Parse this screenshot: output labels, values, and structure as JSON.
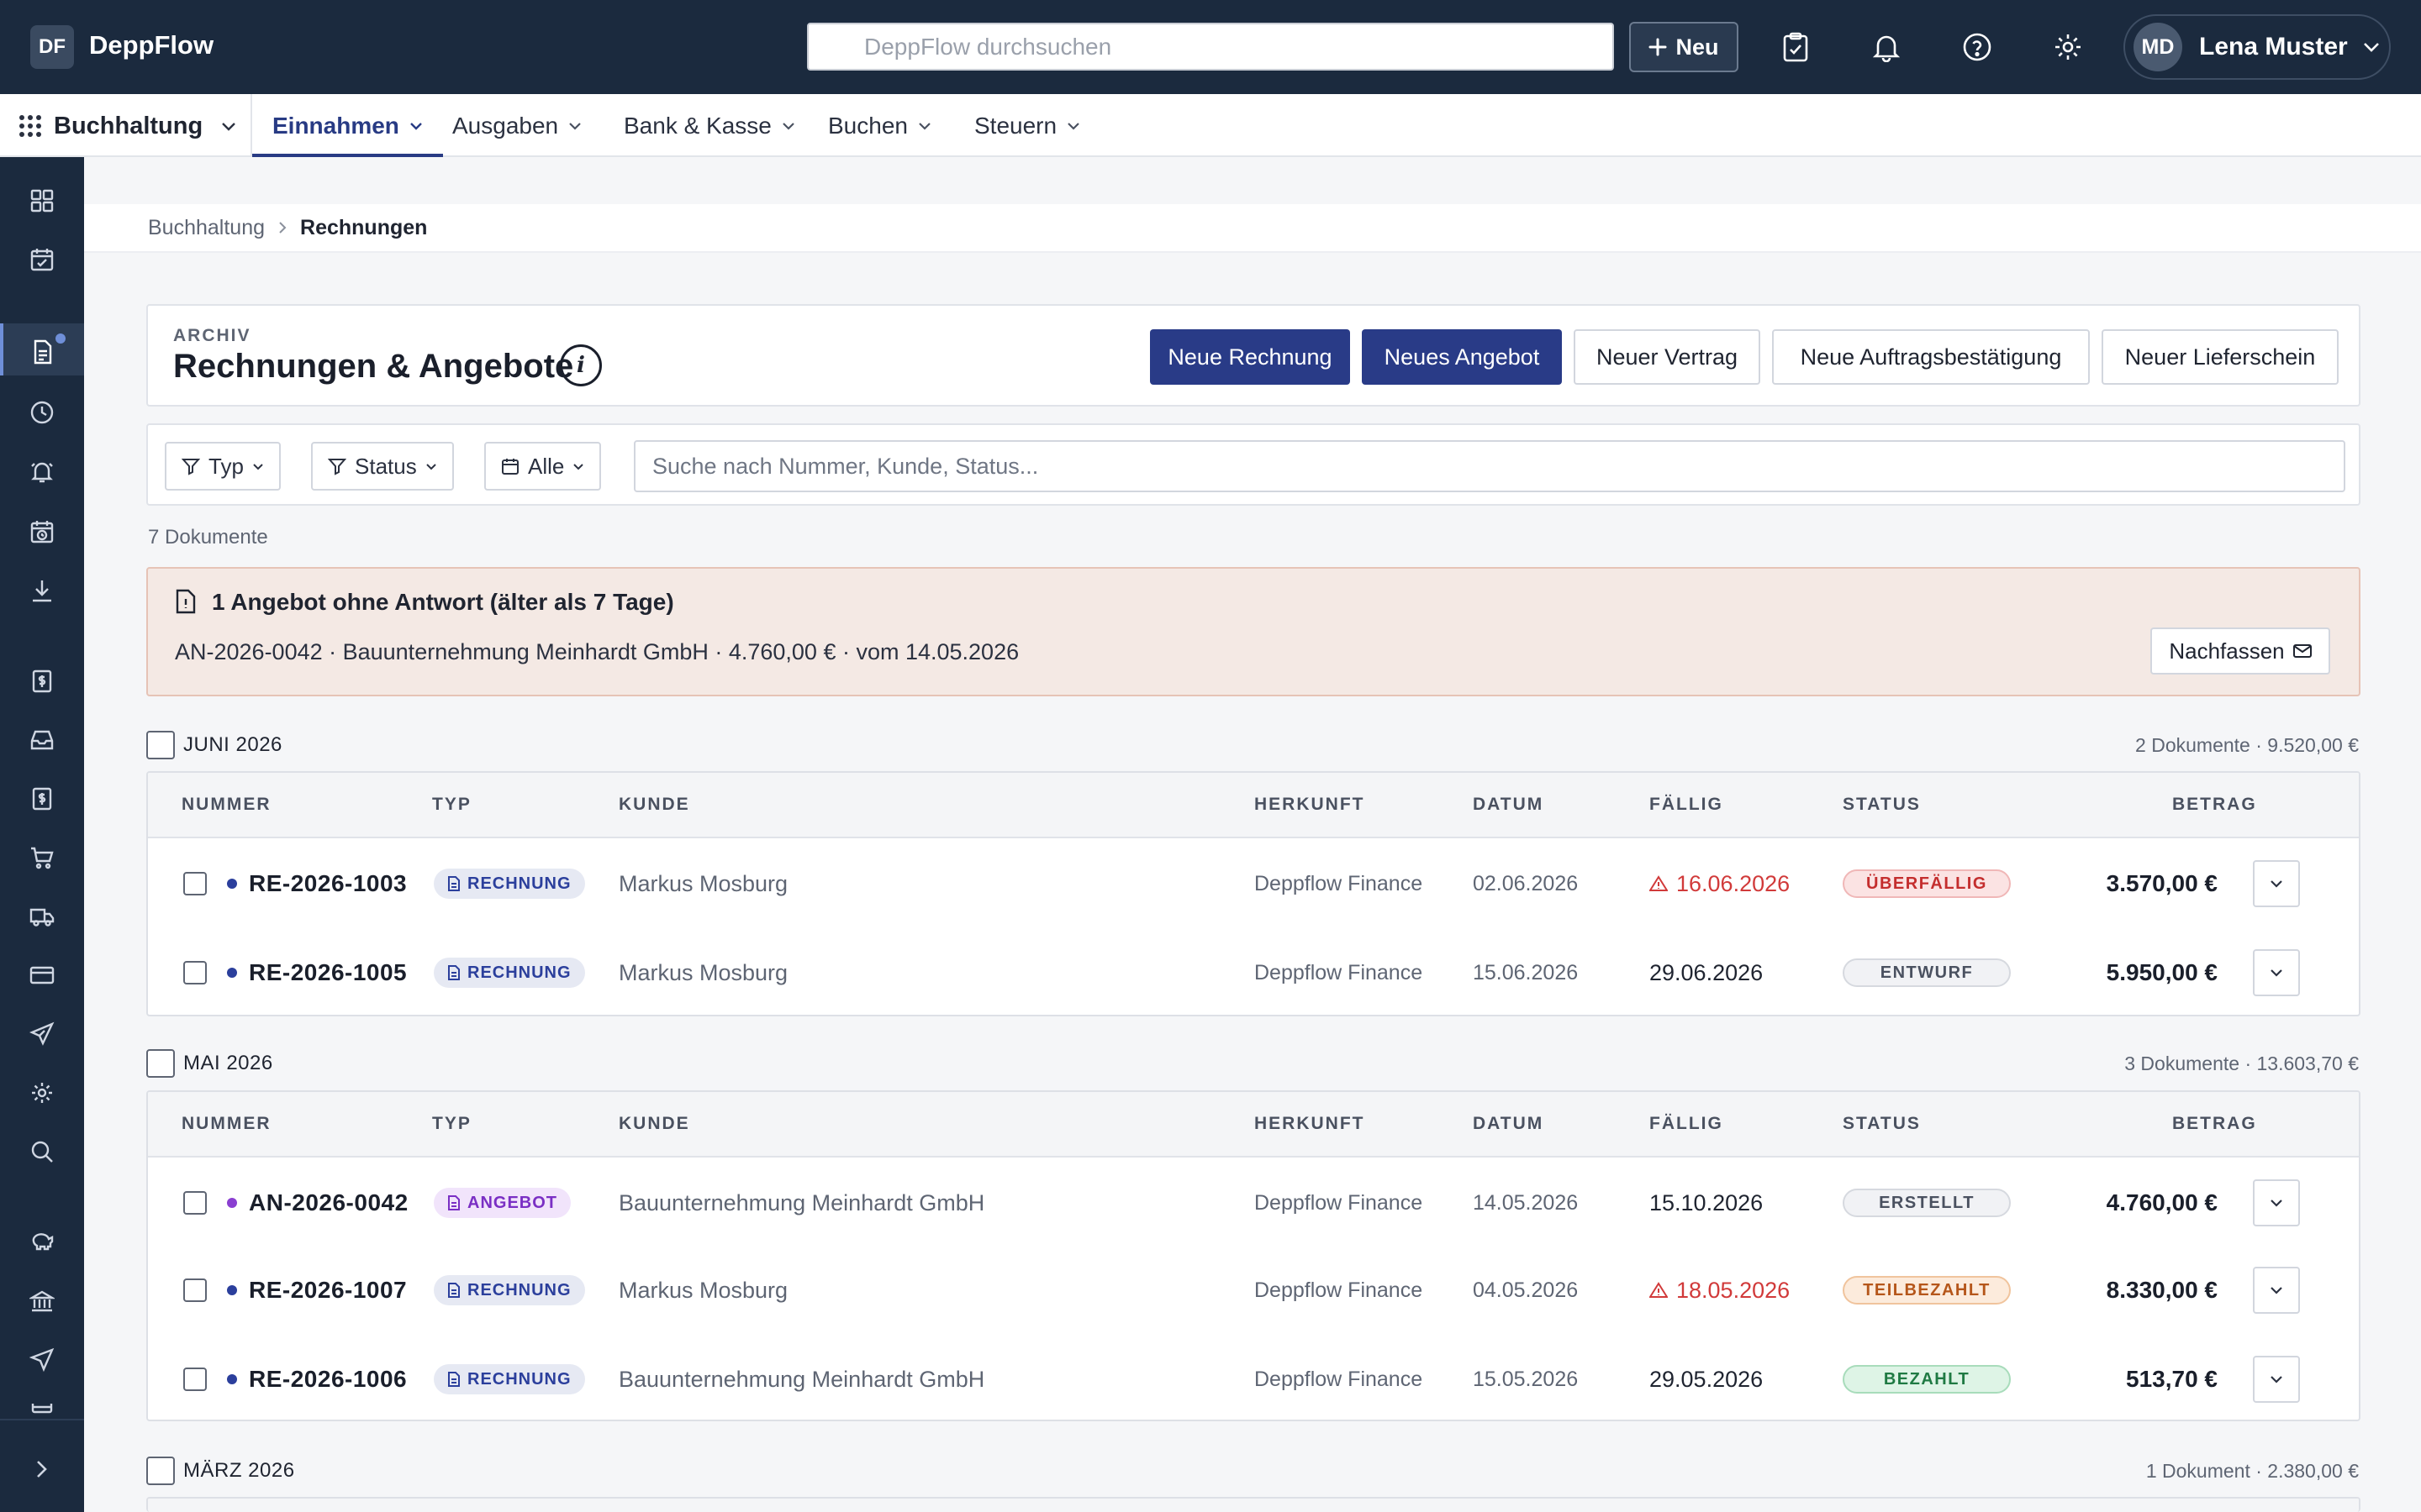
{
  "app": {
    "logo": "DF",
    "name": "DeppFlow"
  },
  "search": {
    "placeholder": "DeppFlow durchsuchen"
  },
  "top": {
    "new_label": "Neu"
  },
  "user": {
    "initials": "MD",
    "name": "Lena Muster"
  },
  "module": {
    "name": "Buchhaltung"
  },
  "nav": [
    {
      "label": "Einnahmen",
      "active": true
    },
    {
      "label": "Ausgaben"
    },
    {
      "label": "Bank & Kasse"
    },
    {
      "label": "Buchen"
    },
    {
      "label": "Steuern"
    }
  ],
  "sidebar_icons": [
    "dashboard-icon",
    "calendar-check-icon",
    "document-icon",
    "clock-icon",
    "bell-icon",
    "calendar-clock-icon",
    "download-icon",
    "invoice-icon",
    "inbox-icon",
    "receipt-icon",
    "cart-icon",
    "truck-icon",
    "card-icon",
    "plane-icon",
    "gear-icon",
    "search-icon",
    "piggy-bank-icon",
    "bank-icon",
    "send-icon",
    "printer-icon",
    "chevron-right-icon"
  ],
  "breadcrumb": {
    "parent": "Buchhaltung",
    "current": "Rechnungen"
  },
  "header": {
    "eyebrow": "ARCHIV",
    "title": "Rechnungen & Angebote",
    "buttons": [
      "Neue Rechnung",
      "Neues Angebot",
      "Neuer Vertrag",
      "Neue Auftragsbestätigung",
      "Neuer Lieferschein"
    ]
  },
  "filters": {
    "type": "Typ",
    "status": "Status",
    "period": "Alle",
    "search_placeholder": "Suche nach Nummer, Kunde, Status..."
  },
  "doc_count": "7 Dokumente",
  "alert": {
    "title": "1 Angebot ohne Antwort (älter als 7 Tage)",
    "text": "AN-2026-0042 · Bauunternehmung Meinhardt GmbH · 4.760,00 € · vom 14.05.2026",
    "button": "Nachfassen"
  },
  "columns": [
    "NUMMER",
    "TYP",
    "KUNDE",
    "HERKUNFT",
    "DATUM",
    "FÄLLIG",
    "STATUS",
    "BETRAG"
  ],
  "groups": [
    {
      "title": "JUNI 2026",
      "summary": "2 Dokumente · 9.520,00 €",
      "rows": [
        {
          "number": "RE-2026-1003",
          "type": "RECHNUNG",
          "customer": "Markus Mosburg",
          "origin": "Deppflow Finance",
          "date": "02.06.2026",
          "due": "16.06.2026",
          "overdue": true,
          "status": "ÜBERFÄLLIG",
          "amount": "3.570,00 €"
        },
        {
          "number": "RE-2026-1005",
          "type": "RECHNUNG",
          "customer": "Markus Mosburg",
          "origin": "Deppflow Finance",
          "date": "15.06.2026",
          "due": "29.06.2026",
          "overdue": false,
          "status": "ENTWURF",
          "amount": "5.950,00 €"
        }
      ]
    },
    {
      "title": "MAI 2026",
      "summary": "3 Dokumente · 13.603,70 €",
      "rows": [
        {
          "number": "AN-2026-0042",
          "type": "ANGEBOT",
          "customer": "Bauunternehmung Meinhardt GmbH",
          "origin": "Deppflow Finance",
          "date": "14.05.2026",
          "due": "15.10.2026",
          "overdue": false,
          "status": "ERSTELLT",
          "amount": "4.760,00 €"
        },
        {
          "number": "RE-2026-1007",
          "type": "RECHNUNG",
          "customer": "Markus Mosburg",
          "origin": "Deppflow Finance",
          "date": "04.05.2026",
          "due": "18.05.2026",
          "overdue": true,
          "status": "TEILBEZAHLT",
          "amount": "8.330,00 €"
        },
        {
          "number": "RE-2026-1006",
          "type": "RECHNUNG",
          "customer": "Bauunternehmung Meinhardt GmbH",
          "origin": "Deppflow Finance",
          "date": "15.05.2026",
          "due": "29.05.2026",
          "overdue": false,
          "status": "BEZAHLT",
          "amount": "513,70 €"
        }
      ]
    },
    {
      "title": "MÄRZ 2026",
      "summary": "1 Dokument · 2.380,00 €",
      "rows": []
    }
  ],
  "colors": {
    "topbar": "#1b2a3e",
    "primary": "#293b87",
    "overdue": "#d13a3a",
    "invoice_dot": "#2b3f9c",
    "offer_dot": "#8a3fd1"
  }
}
